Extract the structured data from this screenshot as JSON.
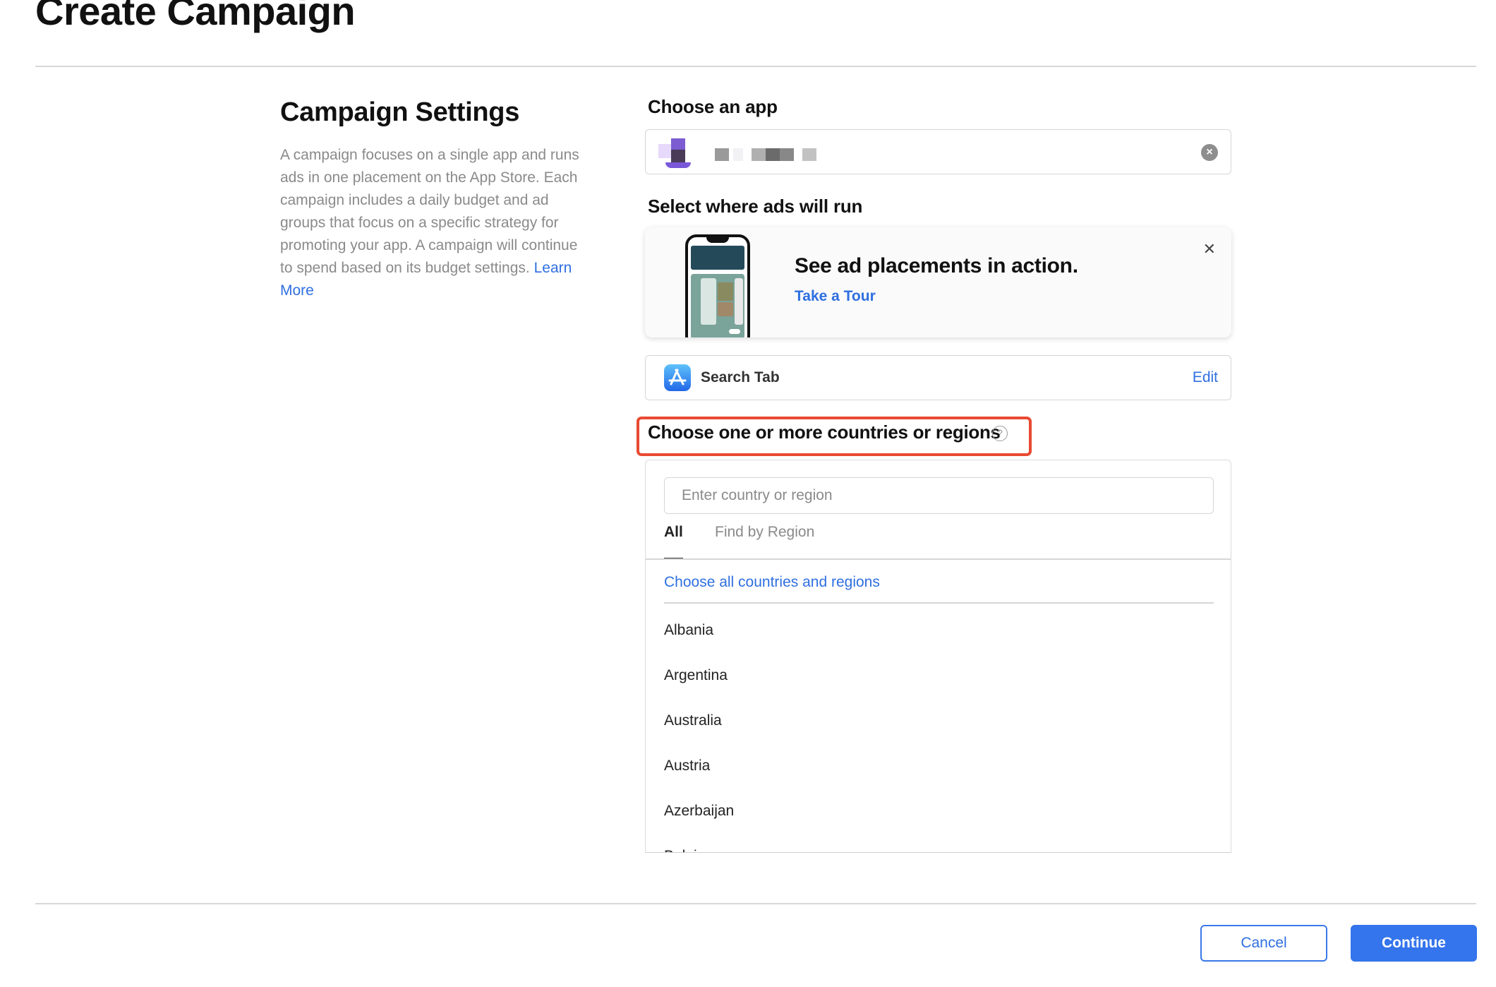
{
  "page": {
    "title": "Create Campaign"
  },
  "settings": {
    "title": "Campaign Settings",
    "description": "A campaign focuses on a single app and runs ads in one placement on the App Store. Each campaign includes a daily budget and ad groups that focus on a specific strategy for promoting your app. A campaign will continue to spend based on its budget settings. ",
    "learn_more": "Learn More"
  },
  "app_chooser": {
    "label": "Choose an app",
    "value_redacted": true,
    "clear_icon": "clear-circle-icon"
  },
  "placement": {
    "label": "Select where ads will run",
    "promo": {
      "title": "See ad placements in action.",
      "link": "Take a Tour",
      "close_icon": "close-icon",
      "close_glyph": "✕",
      "image": "phone-illustration"
    },
    "selected": {
      "icon": "app-store-icon",
      "name": "Search Tab",
      "edit": "Edit"
    }
  },
  "countries": {
    "label": "Choose one or more countries or regions",
    "help_glyph": "?",
    "search_placeholder": "Enter country or region",
    "search_value": "",
    "tabs": [
      {
        "label": "All",
        "active": true
      },
      {
        "label": "Find by Region",
        "active": false
      }
    ],
    "choose_all": "Choose all countries and regions",
    "items": [
      "Albania",
      "Argentina",
      "Australia",
      "Austria",
      "Azerbaijan",
      "Belgium"
    ]
  },
  "footer": {
    "cancel": "Cancel",
    "continue": "Continue"
  },
  "colors": {
    "accent": "#3474ec",
    "link": "#2f6fe0",
    "highlight": "#e84a32"
  }
}
